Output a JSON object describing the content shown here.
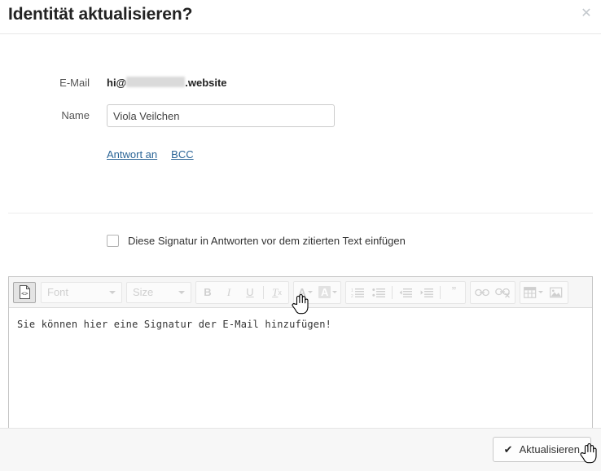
{
  "dialog": {
    "title": "Identität aktualisieren?",
    "close_label": "✕"
  },
  "form": {
    "email": {
      "label": "E-Mail",
      "prefix": "hi@",
      "suffix": ".website",
      "redacted": true
    },
    "name": {
      "label": "Name",
      "value": "Viola Veilchen",
      "placeholder": ""
    },
    "links": [
      {
        "label": "Antwort an"
      },
      {
        "label": "BCC"
      }
    ]
  },
  "options": {
    "signature_before_quote": {
      "label": "Diese Signatur in Antworten vor dem zitierten Text einfügen",
      "checked": false
    }
  },
  "editor": {
    "toolbar": {
      "source_button": {
        "name": "source-code",
        "label": ""
      },
      "font_select": {
        "label": "Font",
        "value": "Font"
      },
      "size_select": {
        "label": "Size",
        "value": "Size"
      },
      "bold": "B",
      "italic": "I",
      "underline": "U",
      "remove_format": "T",
      "remove_format_sub": "x",
      "text_color": "A",
      "background_color": "A",
      "numbered_list": "numbered-list",
      "bulleted_list": "bulleted-list",
      "outdent": "outdent",
      "indent": "indent",
      "blockquote": "”",
      "link": "link",
      "unlink": "unlink",
      "table": "table",
      "image": "image"
    },
    "content": "Sie können hier eine Signatur der E-Mail hinzufügen!"
  },
  "footer": {
    "submit_label": "Aktualisieren",
    "submit_icon": "✔"
  },
  "colors": {
    "link": "#2a6496",
    "toolbar_bg": "#f6f6f6",
    "footer_bg": "#f7f7f7",
    "disabled_icon": "#cfcfcf",
    "redaction": "#dadada"
  }
}
